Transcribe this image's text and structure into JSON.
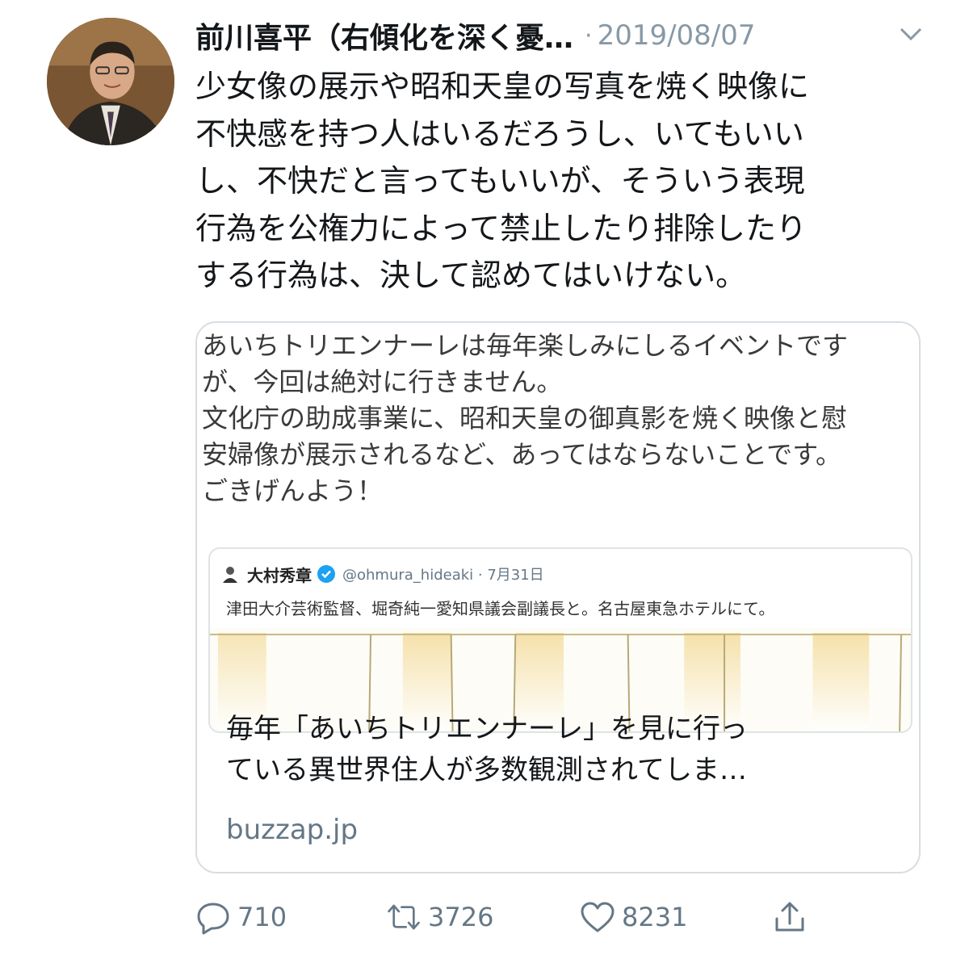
{
  "tweet": {
    "author_name": "前川喜平（右傾化を深く憂…",
    "separator": "·",
    "date": "2019/08/07",
    "text": "少女像の展示や昭和天皇の写真を焼く映像に\n不快感を持つ人はいるだろうし、いてもいい\nし、不快だと言ってもいいが、そういう表現\n行為を公権力によって禁止したり排除したり\nする行為は、決して認めてはいけない。"
  },
  "card": {
    "image_text": "あいちトリエンナーレは毎年楽しみにしるイベントです\nが、今回は絶対に行きません。\n文化庁の助成事業に、昭和天皇の御真影を焼く映像と慰\n安婦像が展示されるなど、あってはならないことです。\nごきげんよう！",
    "embedded": {
      "name": "大村秀章",
      "handle": "@ohmura_hideaki · 7月31日",
      "text": "津田大介芸術監督、堀奇純一愛知県議会副議長と。名古屋東急ホテルにて。"
    },
    "title": "毎年「あいちトリエンナーレ」を見に行っ\nている異世界住人が多数観測されてしま…",
    "domain": "buzzap.jp"
  },
  "actions": {
    "reply_count": "710",
    "retweet_count": "3726",
    "like_count": "8231"
  },
  "icons": [
    "avatar",
    "chevron-down-icon",
    "verified-icon",
    "reply-icon",
    "retweet-icon",
    "like-icon",
    "share-icon"
  ],
  "colors": {
    "text": "#14171a",
    "secondary": "#657786",
    "border": "#d7dde2",
    "verified": "#1da1f2"
  }
}
